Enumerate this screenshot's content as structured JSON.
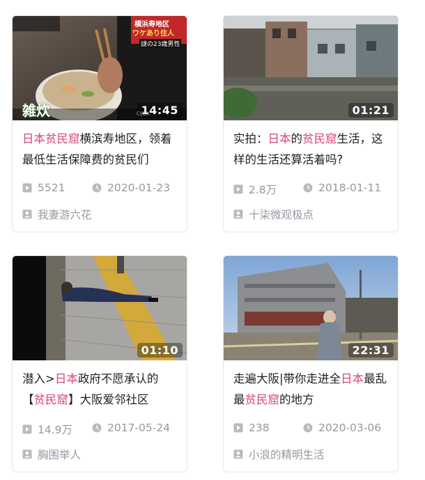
{
  "colors": {
    "highlight": "#d6457a",
    "meta": "#9499a0",
    "border": "#e3e5e7"
  },
  "cards": [
    {
      "thumb": {
        "overlay_top": "ワケあり住人",
        "overlay_small": "横浜寿地区",
        "overlay_sub": "謎の23歳男性",
        "overlay_left": "雑炊",
        "watermark": "OJBK"
      },
      "duration": "14:45",
      "title_parts": [
        {
          "text": "日本贫民窟",
          "hl": true
        },
        {
          "text": "横滨寿地区，领着最低生活保障费的贫民们",
          "hl": false
        }
      ],
      "views": "5521",
      "date": "2020-01-23",
      "author": "我妻游六花"
    },
    {
      "thumb": {},
      "duration": "01:21",
      "title_parts": [
        {
          "text": "实拍：",
          "hl": false
        },
        {
          "text": "日本",
          "hl": true
        },
        {
          "text": "的",
          "hl": false
        },
        {
          "text": "贫民窟",
          "hl": true
        },
        {
          "text": "生活，这样的生活还算活着吗?",
          "hl": false
        }
      ],
      "views": "2.8万",
      "date": "2018-01-11",
      "author": "十柒微观极点"
    },
    {
      "thumb": {},
      "duration": "01:10",
      "title_parts": [
        {
          "text": "潜入>",
          "hl": false
        },
        {
          "text": "日本",
          "hl": true
        },
        {
          "text": "政府不愿承认的【",
          "hl": false
        },
        {
          "text": "贫民窟",
          "hl": true
        },
        {
          "text": "】大阪爱邻社区",
          "hl": false
        }
      ],
      "views": "14.9万",
      "date": "2017-05-24",
      "author": "胸围举人"
    },
    {
      "thumb": {},
      "duration": "22:31",
      "title_parts": [
        {
          "text": "走遍大阪|带你走进全",
          "hl": false
        },
        {
          "text": "日本",
          "hl": true
        },
        {
          "text": "最乱最",
          "hl": false
        },
        {
          "text": "贫民窟",
          "hl": true
        },
        {
          "text": "的地方",
          "hl": false
        }
      ],
      "views": "238",
      "date": "2020-03-06",
      "author": "小浪的精明生活"
    }
  ]
}
